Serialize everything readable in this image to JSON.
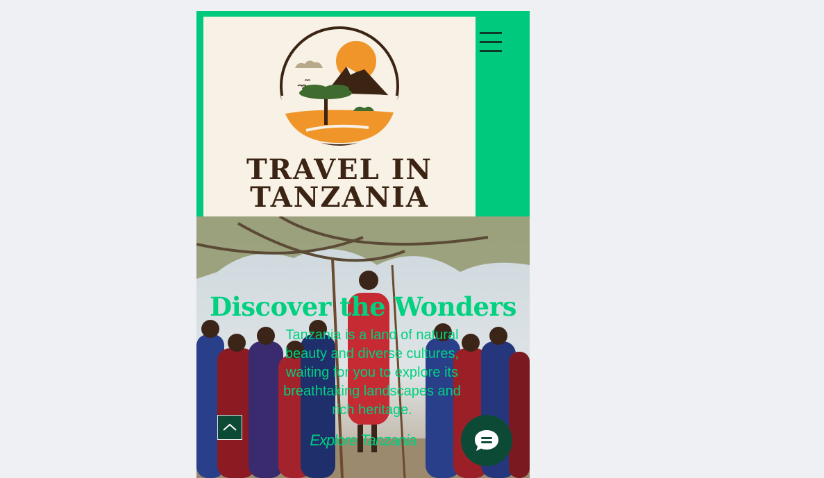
{
  "header": {
    "logo_line1": "TRAVEL IN",
    "logo_line2": "TANZANIA",
    "menu_icon": "hamburger-menu-icon"
  },
  "hero": {
    "title": "Discover the Wonders",
    "description": "Tanzania is a land of natural beauty and diverse cultures, waiting for you to explore its breathtaking landscapes and rich heritage.",
    "cta_label": "Explore Tanzania"
  },
  "widgets": {
    "scroll_top_icon": "chevron-up-icon",
    "chat_icon": "chat-bubble-icon"
  },
  "colors": {
    "brand_green": "#00c97d",
    "logo_bg": "#f8f1e5",
    "logo_brown": "#3b2413",
    "sun_orange": "#f0952a",
    "widget_dark": "#0d4a36"
  }
}
